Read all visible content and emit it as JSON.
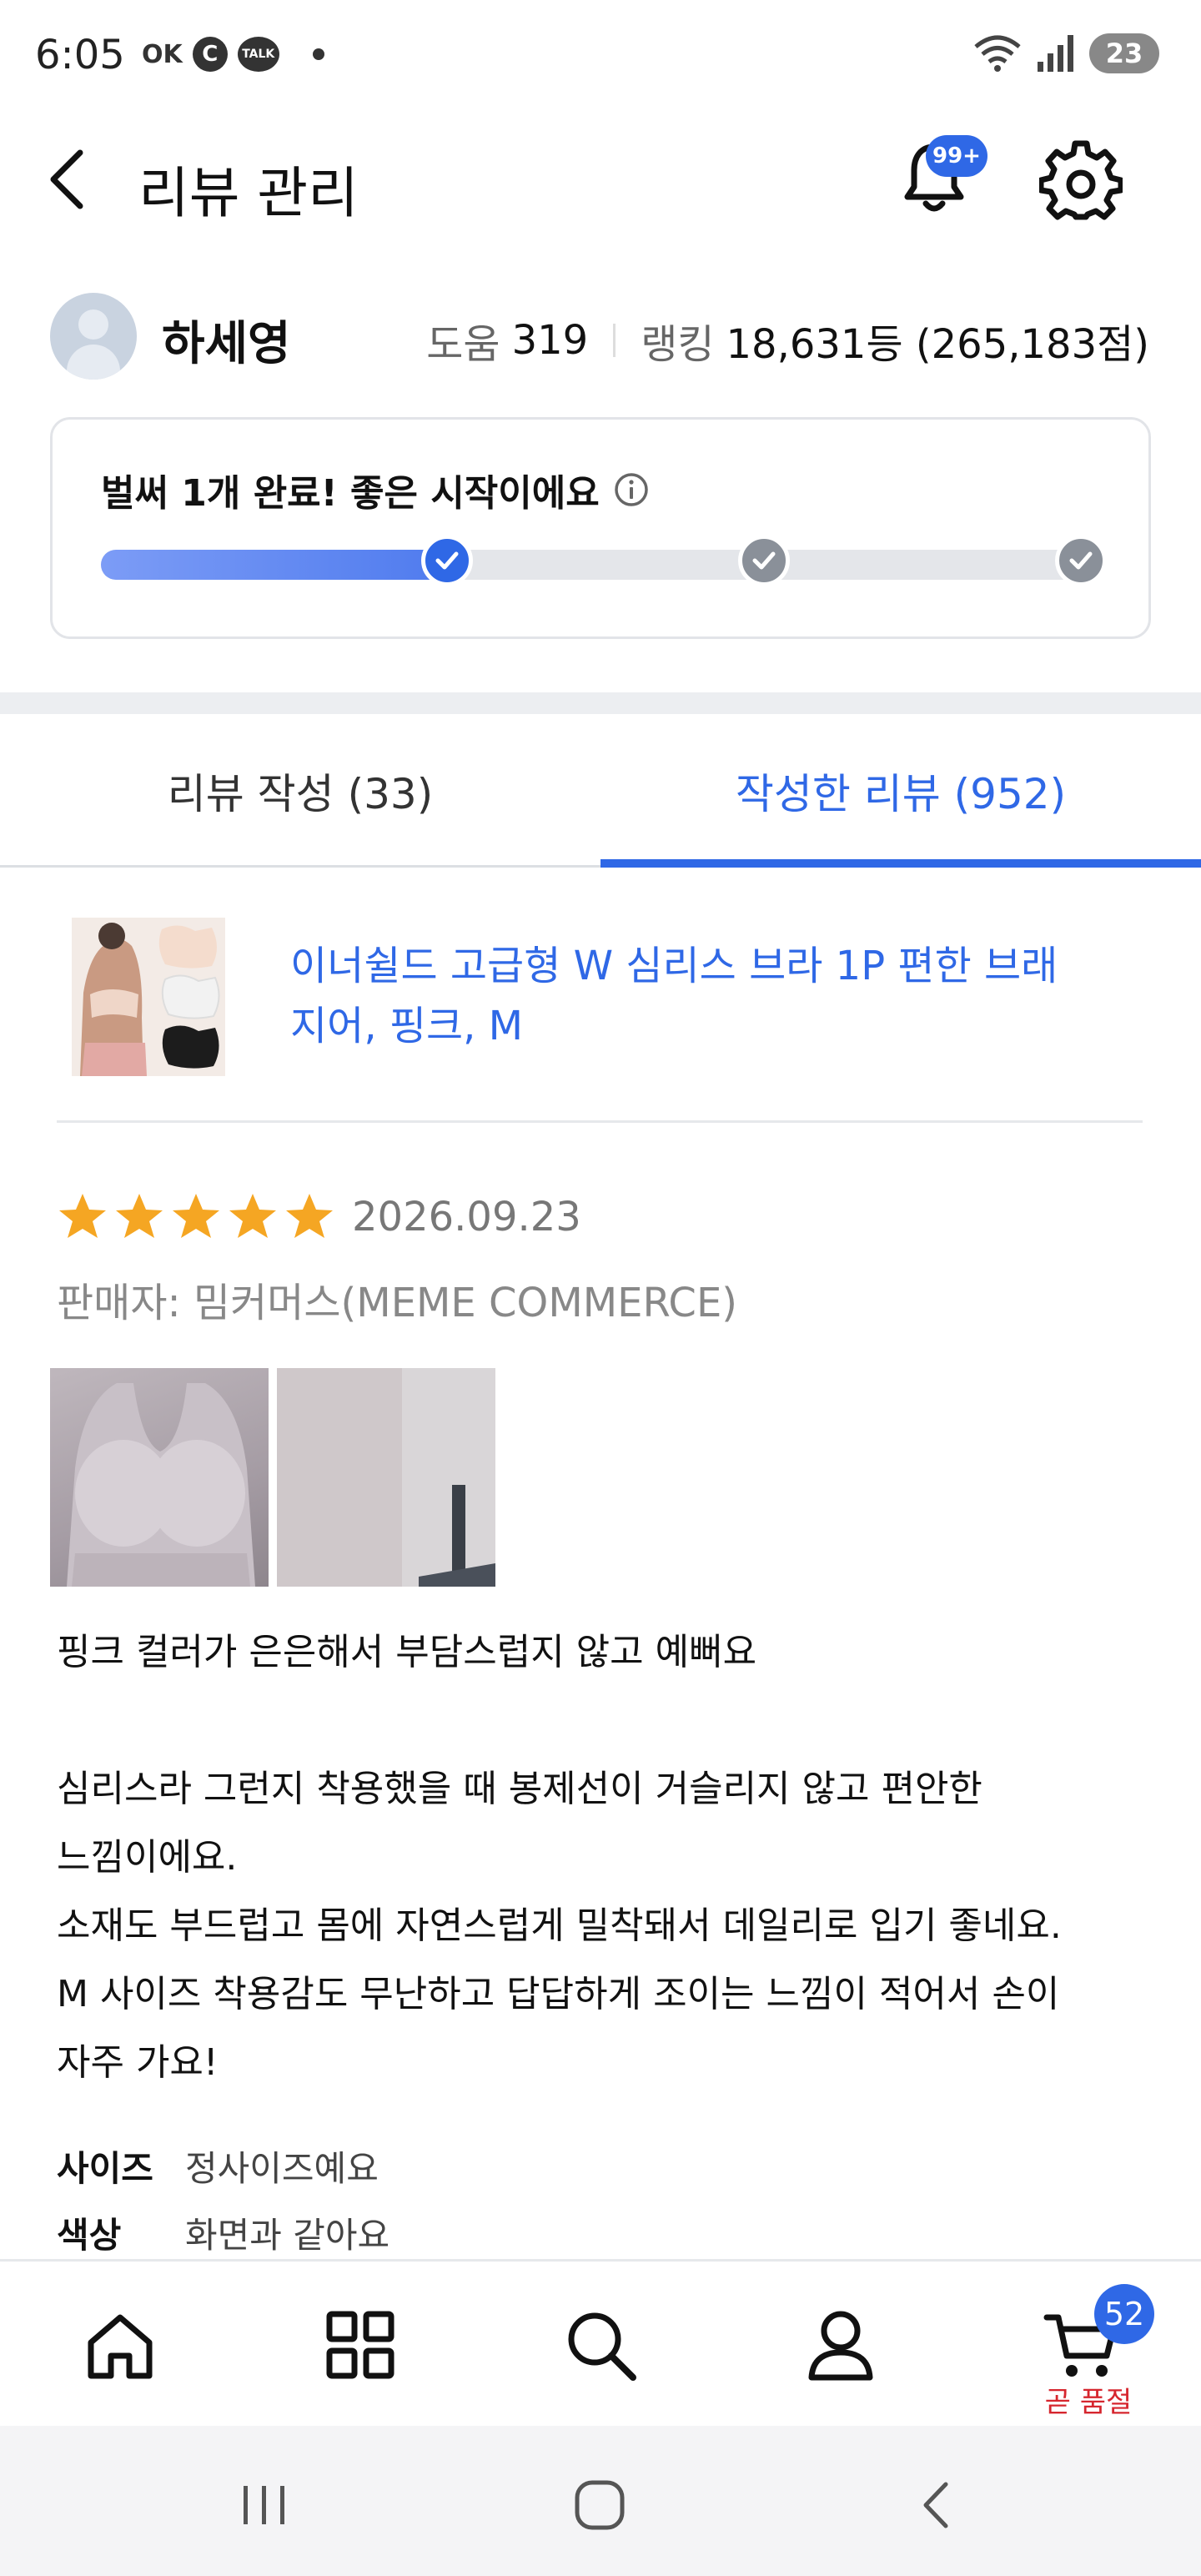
{
  "status_bar": {
    "time": "6:05",
    "icons_left": [
      "ok-icon",
      "c-icon",
      "talk-icon",
      "dot-icon"
    ],
    "ok_text": "OK",
    "c_text": "C",
    "talk_text": "TALK",
    "battery": "23"
  },
  "header": {
    "title": "리뷰 관리",
    "notification_badge": "99+"
  },
  "profile": {
    "name": "하세영",
    "help_label": "도움",
    "help_value": "319",
    "ranking_label": "랭킹",
    "ranking_value": "18,631등 (265,183점)"
  },
  "progress": {
    "title": "벌써 1개 완료! 좋은 시작이에요",
    "completed_steps": 1,
    "total_steps": 3,
    "fill_fraction": 0.35
  },
  "tabs": [
    {
      "label": "리뷰 작성 (33)",
      "active": false
    },
    {
      "label": "작성한 리뷰 (952)",
      "active": true
    }
  ],
  "product": {
    "name": "이너쉴드 고급형 W 심리스 브라 1P 편한 브래지어, 핑크, M"
  },
  "review": {
    "rating": 5,
    "date": "2026.09.23",
    "seller": "판매자: 밈커머스(MEME COMMERCE)",
    "body": "핑크 컬러가 은은해서 부담스럽지 않고 예뻐요\n\n심리스라 그런지 착용했을 때 봉제선이 거슬리지 않고 편안한\n느낌이에요.\n소재도 부드럽고 몸에 자연스럽게 밀착돼서 데일리로 입기 좋네요.\nM 사이즈 착용감도 무난하고 답답하게 조이는 느낌이 적어서 손이\n자주 가요!",
    "attributes": [
      {
        "key": "사이즈",
        "value": "정사이즈예요"
      },
      {
        "key": "색상",
        "value": "화면과 같아요"
      }
    ]
  },
  "bottom_nav": {
    "items": [
      "home-icon",
      "category-grid-icon",
      "search-icon",
      "account-icon",
      "cart-icon"
    ],
    "cart_count": "52",
    "cart_status": "곧 품절"
  },
  "colors": {
    "accent": "#2f68e6",
    "star": "#f5a623",
    "alert": "#d6262e"
  }
}
